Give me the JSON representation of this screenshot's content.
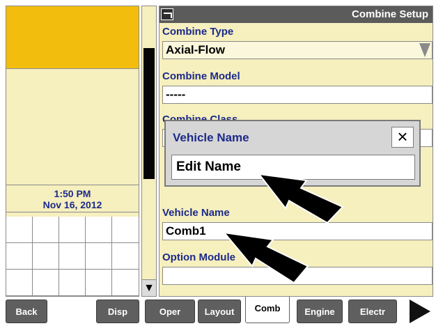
{
  "left_panel": {
    "time": "1:50 PM",
    "date": "Nov 16, 2012"
  },
  "window": {
    "title": "Combine Setup"
  },
  "fields": {
    "combine_type_label": "Combine Type",
    "combine_type_value": "Axial-Flow",
    "combine_model_label": "Combine Model",
    "combine_model_value": "-----",
    "combine_class_label": "Combine Class",
    "vehicle_name_label": "Vehicle Name",
    "vehicle_name_value": "Comb1",
    "option_module_label": "Option Module"
  },
  "dialog": {
    "title": "Vehicle Name",
    "close_glyph": "×",
    "option": "Edit Name"
  },
  "tabs": [
    "Back",
    "Disp",
    "Oper",
    "Layout",
    "Comb",
    "Engine",
    "Electr"
  ],
  "active_tab": "Comb",
  "icons": {
    "title": "tractor-icon",
    "scroll_down": "down-arrow-icon",
    "next": "next-arrow-icon"
  }
}
